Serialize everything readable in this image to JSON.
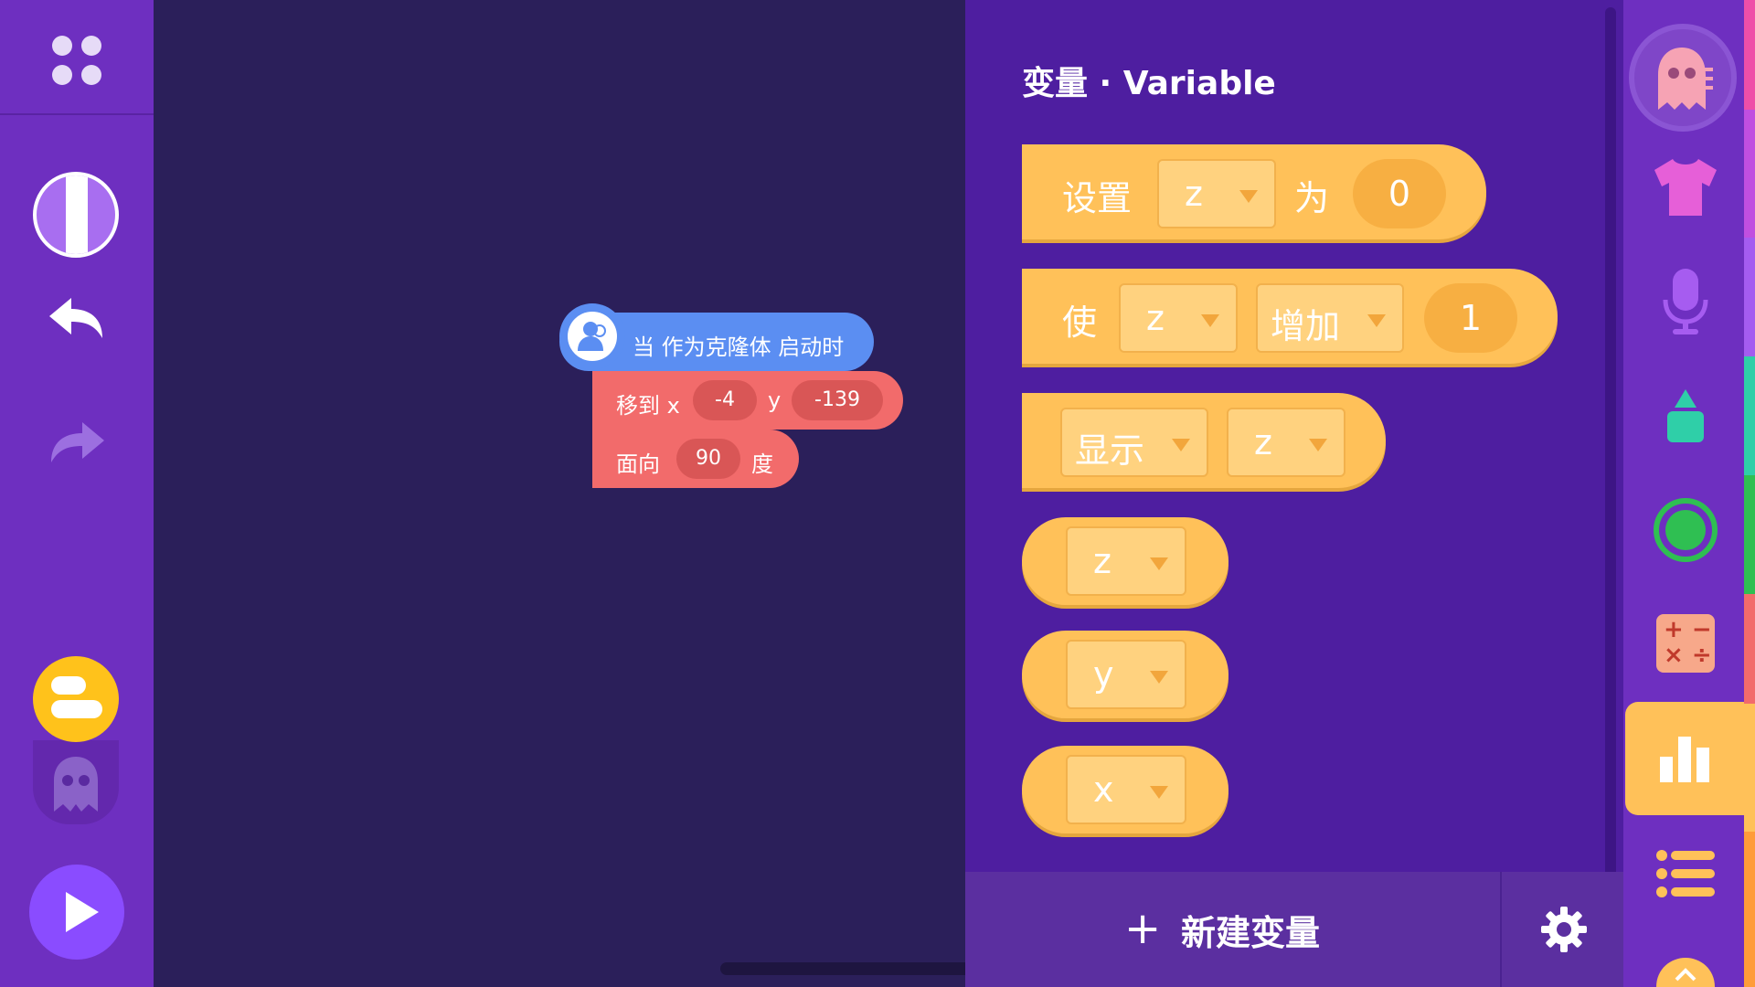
{
  "workspace": {
    "hat_block": {
      "text": "当 作为克隆体 启动时"
    },
    "move_block": {
      "label_x": "移到 x",
      "x_value": "-4",
      "label_y": "y",
      "y_value": "-139"
    },
    "face_block": {
      "label": "面向",
      "value": "90",
      "unit": "度"
    }
  },
  "palette": {
    "title": "变量 · Variable",
    "set_block": {
      "label": "设置",
      "variable": "z",
      "label_to": "为",
      "value": "0"
    },
    "change_block": {
      "label": "使",
      "variable": "z",
      "operation": "增加",
      "value": "1"
    },
    "show_block": {
      "operation": "显示",
      "variable": "z"
    },
    "reporters": [
      {
        "variable": "z"
      },
      {
        "variable": "y"
      },
      {
        "variable": "x"
      }
    ],
    "new_variable_label": "新建变量",
    "new_variable_plus": "+"
  },
  "categories": [
    {
      "icon": "sprite-costume-icon"
    },
    {
      "icon": "shirt-icon"
    },
    {
      "icon": "microphone-icon"
    },
    {
      "icon": "pen-icon"
    },
    {
      "icon": "events-icon"
    },
    {
      "icon": "operators-icon"
    },
    {
      "icon": "variables-icon",
      "active": true
    },
    {
      "icon": "list-icon"
    },
    {
      "icon": "more-icon"
    }
  ],
  "colors": {
    "variables": "#ffc159",
    "motion": "#f26b6b",
    "control": "#5b8ef2",
    "sidebar": "#6e2fc0",
    "palette": "#4e1ea0"
  }
}
